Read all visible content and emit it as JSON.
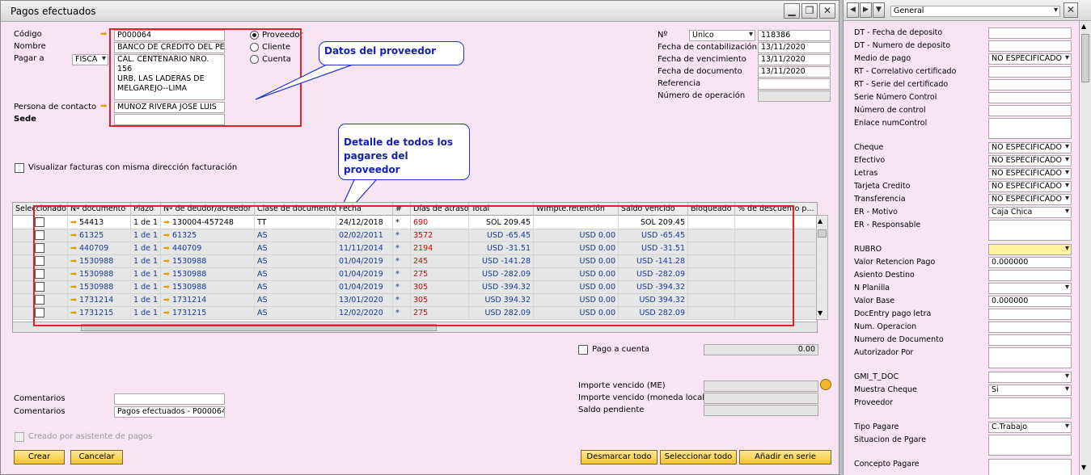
{
  "window": {
    "title": "Pagos efectuados"
  },
  "header": {
    "codigo_label": "Código",
    "codigo_value": "P000064",
    "nombre_label": "Nombre",
    "nombre_value": "BANCO DE CREDITO DEL PE",
    "pagar_a_label": "Pagar a",
    "pagar_a_value": "FISCA",
    "address_line1": "CAL. CENTENARIO NRO. 156",
    "address_line2": "URB. LAS LADERAS DE",
    "address_line3": "MELGAREJO--LIMA",
    "contacto_label": "Persona de contacto",
    "contacto_value": "MUÑOZ RIVERA JOSE LUIS",
    "sede_label": "Sede",
    "radio_proveedor": "Proveedor",
    "radio_cliente": "Cliente",
    "radio_cuenta": "Cuenta",
    "no_label": "Nº",
    "no_series": "Unico",
    "no_value": "118386",
    "fecha_contab_label": "Fecha de contabilización",
    "fecha_contab": "13/11/2020",
    "fecha_venc_label": "Fecha de vencimiento",
    "fecha_venc": "13/11/2020",
    "fecha_doc_label": "Fecha de documento",
    "fecha_doc": "13/11/2020",
    "referencia_label": "Referencia",
    "num_operacion_label": "Número de operación",
    "visualizar_label": "Visualizar facturas con misma dirección facturación"
  },
  "callouts": {
    "proveedor": "Datos del proveedor",
    "detalle_line1": "Detalle de todos los",
    "detalle_line2": "pagares del proveedor"
  },
  "grid": {
    "columns": [
      "Seleccionado",
      "Nº documento",
      "Plazo",
      "Nº de deudor/acreedor",
      "Clase de documento",
      "Fecha",
      "#",
      "Días de atraso",
      "Total",
      "WImpte.retención",
      "Saldo vencido",
      "Bloqueado",
      "% de descuento p..."
    ],
    "rows": [
      {
        "doc": "54413",
        "plazo": "1 de 1",
        "deudor": "130004-457248",
        "clase": "TT",
        "fecha": "24/12/2018",
        "hash": "*",
        "dias": "690",
        "total": "SOL 209.45",
        "wimpte": "",
        "saldo": "SOL 209.45"
      },
      {
        "doc": "61325",
        "plazo": "1 de 1",
        "deudor": "61325",
        "clase": "AS",
        "fecha": "02/02/2011",
        "hash": "*",
        "dias": "3572",
        "total": "USD -65.45",
        "wimpte": "USD 0.00",
        "saldo": "USD -65.45"
      },
      {
        "doc": "440709",
        "plazo": "1 de 1",
        "deudor": "440709",
        "clase": "AS",
        "fecha": "11/11/2014",
        "hash": "*",
        "dias": "2194",
        "total": "USD -31.51",
        "wimpte": "USD 0.00",
        "saldo": "USD -31.51"
      },
      {
        "doc": "1530988",
        "plazo": "1 de 1",
        "deudor": "1530988",
        "clase": "AS",
        "fecha": "01/04/2019",
        "hash": "*",
        "dias": "245",
        "total": "USD -141.28",
        "wimpte": "USD 0.00",
        "saldo": "USD -141.28"
      },
      {
        "doc": "1530988",
        "plazo": "1 de 1",
        "deudor": "1530988",
        "clase": "AS",
        "fecha": "01/04/2019",
        "hash": "*",
        "dias": "275",
        "total": "USD -282.09",
        "wimpte": "USD 0.00",
        "saldo": "USD -282.09"
      },
      {
        "doc": "1530988",
        "plazo": "1 de 1",
        "deudor": "1530988",
        "clase": "AS",
        "fecha": "01/04/2019",
        "hash": "*",
        "dias": "305",
        "total": "USD -394.32",
        "wimpte": "USD 0.00",
        "saldo": "USD -394.32"
      },
      {
        "doc": "1731214",
        "plazo": "1 de 1",
        "deudor": "1731214",
        "clase": "AS",
        "fecha": "13/01/2020",
        "hash": "*",
        "dias": "305",
        "total": "USD 394.32",
        "wimpte": "USD 0.00",
        "saldo": "USD 394.32"
      },
      {
        "doc": "1731215",
        "plazo": "1 de 1",
        "deudor": "1731215",
        "clase": "AS",
        "fecha": "12/02/2020",
        "hash": "*",
        "dias": "275",
        "total": "USD 282.09",
        "wimpte": "USD 0.00",
        "saldo": "USD 282.09"
      }
    ]
  },
  "footer": {
    "pago_cuenta_label": "Pago a cuenta",
    "pago_cuenta_value": "0.00",
    "importe_me_label": "Importe vencido (ME)",
    "importe_local_label": "Importe vencido (moneda local)",
    "saldo_pendiente_label": "Saldo pendiente",
    "comentarios_label": "Comentarios",
    "comentarios2_label": "Comentarios",
    "comentarios2_value": "Pagos efectuados - P000064",
    "creado_label": "Creado por asistente de pagos",
    "btn_crear": "Crear",
    "btn_cancelar": "Cancelar",
    "btn_desmarcar": "Desmarcar todo",
    "btn_seleccionar": "Seleccionar todo",
    "btn_anadir": "Añadir en serie"
  },
  "side": {
    "dropdown": "General",
    "fields": [
      {
        "label": "DT - Fecha de deposito",
        "value": "",
        "type": "text"
      },
      {
        "label": "DT - Numero de deposito",
        "value": "",
        "type": "text"
      },
      {
        "label": "Medio de pago",
        "value": "NO ESPECIFICADO",
        "type": "drop"
      },
      {
        "label": "RT - Correlativo certificado",
        "value": "",
        "type": "text"
      },
      {
        "label": "RT - Serie del certificado",
        "value": "",
        "type": "text"
      },
      {
        "label": "Serie Número Control",
        "value": "",
        "type": "text"
      },
      {
        "label": "Número de control",
        "value": "",
        "type": "text"
      },
      {
        "label": "Enlace numControl",
        "value": "",
        "type": "area"
      },
      {
        "label": "Cheque",
        "value": "NO ESPECIFICADO",
        "type": "drop"
      },
      {
        "label": "Efectivo",
        "value": "NO ESPECIFICADO",
        "type": "drop"
      },
      {
        "label": "Letras",
        "value": "NO ESPECIFICADO",
        "type": "drop"
      },
      {
        "label": "Tarjeta Credito",
        "value": "NO ESPECIFICADO",
        "type": "drop"
      },
      {
        "label": "Transferencia",
        "value": "NO ESPECIFICADO",
        "type": "drop"
      },
      {
        "label": "ER - Motivo",
        "value": "Caja Chica",
        "type": "drop"
      },
      {
        "label": "ER - Responsable",
        "value": "",
        "type": "area"
      },
      {
        "label": "RUBRO",
        "value": "",
        "type": "yel"
      },
      {
        "label": "Valor Retencion Pago",
        "value": "0.000000",
        "type": "text"
      },
      {
        "label": "Asiento Destino",
        "value": "",
        "type": "text"
      },
      {
        "label": "N Planilla",
        "value": "",
        "type": "drop"
      },
      {
        "label": "Valor Base",
        "value": "0.000000",
        "type": "text"
      },
      {
        "label": "DocEntry pago letra",
        "value": "",
        "type": "text"
      },
      {
        "label": "Num. Operacion",
        "value": "",
        "type": "text"
      },
      {
        "label": "Numero de Documento",
        "value": "",
        "type": "text"
      },
      {
        "label": "Autorizador Por",
        "value": "",
        "type": "area"
      },
      {
        "label": "GMI_T_DOC",
        "value": "",
        "type": "drop"
      },
      {
        "label": "Muestra Cheque",
        "value": "Si",
        "type": "drop"
      },
      {
        "label": "Proveedor",
        "value": "",
        "type": "area"
      },
      {
        "label": "Tipo Pagare",
        "value": "C.Trabajo",
        "type": "drop"
      },
      {
        "label": "Situacion de Pgare",
        "value": "",
        "type": "area"
      },
      {
        "label": "Concepto Pagare",
        "value": "",
        "type": "area"
      }
    ]
  }
}
